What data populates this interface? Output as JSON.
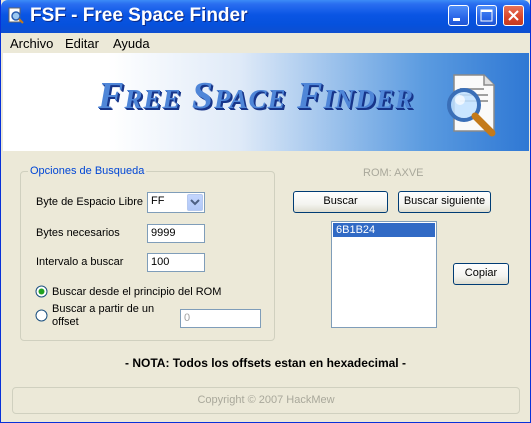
{
  "window": {
    "title": "FSF - Free Space Finder",
    "controls": {
      "minimize": "minimize-icon",
      "maximize": "maximize-icon",
      "close": "close-icon"
    }
  },
  "menu": {
    "items": [
      "Archivo",
      "Editar",
      "Ayuda"
    ]
  },
  "banner": {
    "title": "Free Space Finder",
    "icon": "magnifier-document-icon"
  },
  "options": {
    "legend": "Opciones de Busqueda",
    "byte_label": "Byte de Espacio Libre",
    "byte_value": "FF",
    "bytes_needed_label": "Bytes necesarios",
    "bytes_needed_value": "9999",
    "interval_label": "Intervalo a buscar",
    "interval_value": "100",
    "radio_start_label": "Buscar desde el principio del ROM",
    "radio_start_checked": true,
    "radio_offset_label_line1": "Buscar a partir de un",
    "radio_offset_label_line2": "offset",
    "radio_offset_checked": false,
    "offset_value": "0"
  },
  "rom": {
    "label": "ROM: AXVE"
  },
  "actions": {
    "search": "Buscar",
    "search_next": "Buscar siguiente",
    "copy": "Copiar"
  },
  "results": {
    "items": [
      "6B1B24"
    ],
    "selected_index": 0
  },
  "note": "- NOTA: Todos los offsets estan en hexadecimal -",
  "footer": {
    "copyright": "Copyright © 2007 HackMew"
  },
  "colors": {
    "titlebar": "#0a55e4",
    "selection": "#316ac5",
    "legend": "#0046d5",
    "banner_text": "#4f86d8"
  }
}
